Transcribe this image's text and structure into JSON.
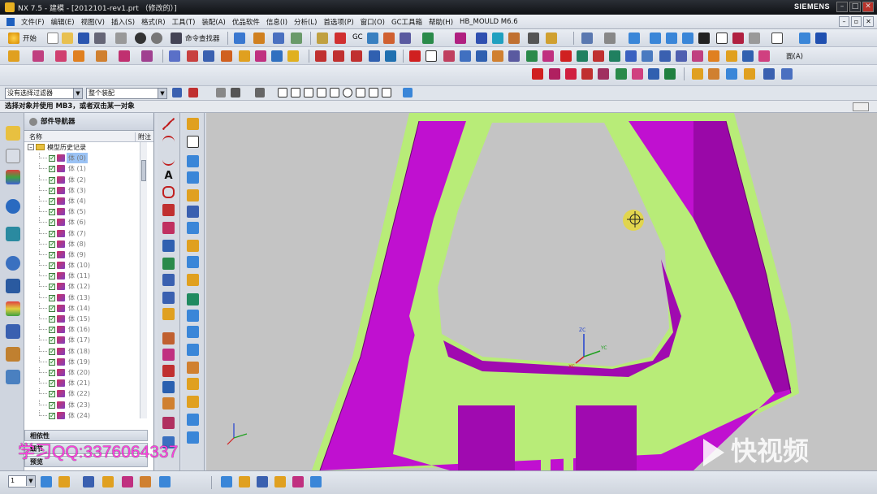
{
  "window": {
    "title": "NX 7.5 - 建模 - [2012101-rev1.prt （修改的）]",
    "brand": "SIEMENS",
    "controls": [
      "–",
      "□",
      "✕"
    ]
  },
  "menu": {
    "items": [
      "文件(F)",
      "编辑(E)",
      "视图(V)",
      "插入(S)",
      "格式(R)",
      "工具(T)",
      "装配(A)",
      "优品软件",
      "信息(I)",
      "分析(L)",
      "首选项(P)",
      "窗口(O)",
      "GC工具箱",
      "帮助(H)",
      "HB_MOULD M6.6"
    ]
  },
  "toolbar": {
    "start_label": "开始",
    "command_finder_label": "命令查找器",
    "face_label": "面(A)"
  },
  "selection": {
    "filter_value": "没有选择过滤器",
    "scope_value": "整个装配"
  },
  "status": {
    "prompt": "选择对象并使用 MB3，或者双击某一对象"
  },
  "navigator": {
    "title": "部件导航器",
    "col_name": "名称",
    "col_attach": "附注",
    "root": "模型历史记录",
    "items": [
      "体 (0)",
      "体 (1)",
      "体 (2)",
      "体 (3)",
      "体 (4)",
      "体 (5)",
      "体 (6)",
      "体 (7)",
      "体 (8)",
      "体 (9)",
      "体 (10)",
      "体 (11)",
      "体 (12)",
      "体 (13)",
      "体 (14)",
      "体 (15)",
      "体 (16)",
      "体 (17)",
      "体 (18)",
      "体 (19)",
      "体 (20)",
      "体 (21)",
      "体 (22)",
      "体 (23)",
      "体 (24)"
    ],
    "selected_index": 0,
    "panel_dependencies": "相依性",
    "panel_details": "细节",
    "panel_preview": "预览"
  },
  "viewport": {
    "axis_z": "ZC",
    "axis_y": "YC",
    "axis_x": "XC"
  },
  "bottom": {
    "layer_value": "1"
  },
  "watermarks": {
    "qq": "学习QQ:3376064337",
    "logo": "快视频"
  },
  "colors": {
    "part_magenta": "#c010d0",
    "part_green": "#b8ec78",
    "background": "#c4c4c4"
  }
}
